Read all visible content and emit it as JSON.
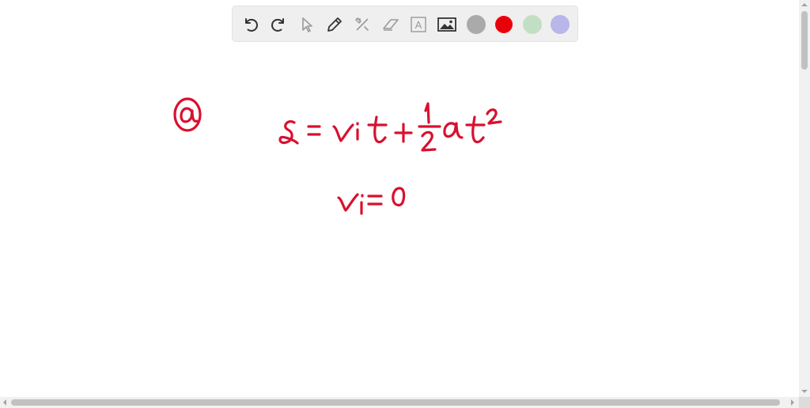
{
  "toolbar": {
    "tools": [
      {
        "name": "undo",
        "icon": "undo-icon"
      },
      {
        "name": "redo",
        "icon": "redo-icon"
      },
      {
        "name": "select",
        "icon": "cursor-icon"
      },
      {
        "name": "pen",
        "icon": "pencil-icon"
      },
      {
        "name": "tools",
        "icon": "hammer-wrench-icon"
      },
      {
        "name": "eraser",
        "icon": "eraser-icon"
      },
      {
        "name": "text",
        "icon": "text-box-icon",
        "label": "A"
      },
      {
        "name": "image",
        "icon": "image-icon"
      }
    ],
    "colors": [
      {
        "name": "gray",
        "hex": "#aaaaaa"
      },
      {
        "name": "red",
        "hex": "#e8000b",
        "selected": true
      },
      {
        "name": "light-green",
        "hex": "#c3dfc3"
      },
      {
        "name": "lavender",
        "hex": "#b9b6ea"
      }
    ]
  },
  "ink_color": "#d9102e"
}
